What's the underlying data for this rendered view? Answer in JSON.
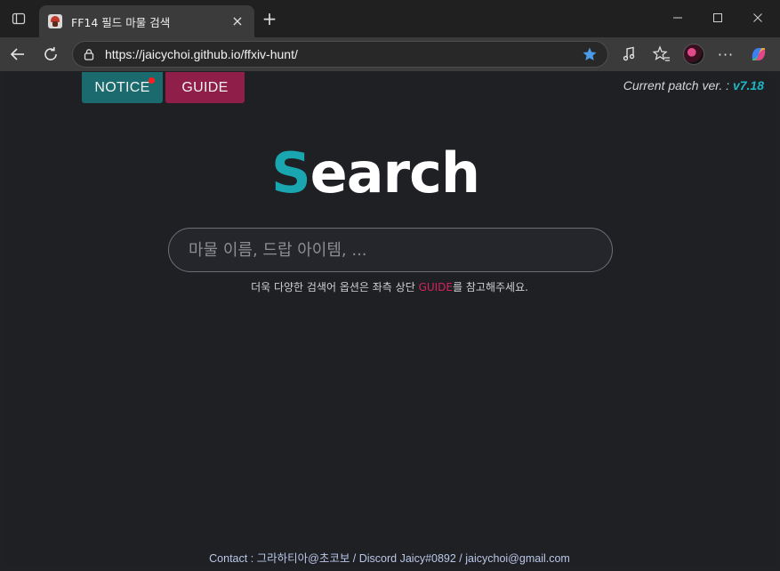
{
  "browser": {
    "tab_title": "FF14 필드 마물 검색",
    "tab_close": "×",
    "new_tab": "+",
    "url": "https://jaicychoi.github.io/ffxiv-hunt/",
    "icons": [
      "tab-actions-icon",
      "close-icon",
      "plus-icon",
      "minimize-icon",
      "maximize-icon",
      "window-close-icon",
      "back-arrow-icon",
      "reload-icon",
      "lock-icon",
      "star-icon",
      "media-icon",
      "favorites-icon",
      "profile-avatar",
      "more-icon",
      "copilot-icon"
    ]
  },
  "header": {
    "notice_label": "NOTICE",
    "guide_label": "GUIDE",
    "patch_prefix": "Current patch ver. : ",
    "patch_version": "v7.18"
  },
  "logo": {
    "first_letter": "S",
    "rest": "earch"
  },
  "search": {
    "placeholder": "마물 이름, 드랍 아이템, ...",
    "value": ""
  },
  "hint": {
    "before": "더욱 다양한 검색어 옵션은 좌측 상단 ",
    "link": "GUIDE",
    "after": "를 참고해주세요."
  },
  "footer": {
    "text": "Contact : 그라하티아@초코보 / Discord Jaicy#0892 / jaicychoi@gmail.com"
  },
  "colors": {
    "notice_bg": "#1b6b6e",
    "guide_bg": "#8f1f48",
    "accent_teal": "#1aa6b0",
    "guide_link": "#d1245a",
    "page_bg": "#1f2024"
  }
}
